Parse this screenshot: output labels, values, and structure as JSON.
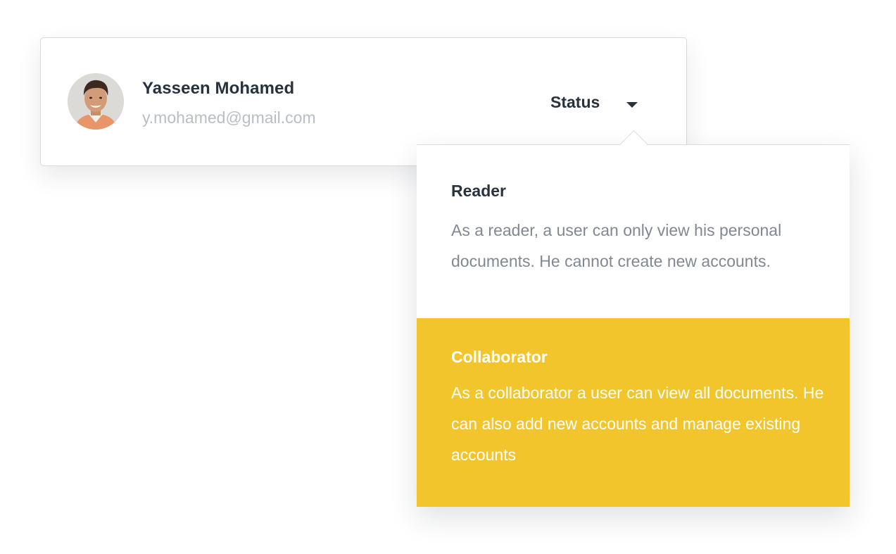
{
  "user": {
    "name": "Yasseen Mohamed",
    "email": "y.mohamed@gmail.com",
    "avatar_icon": "user-avatar-photo"
  },
  "status": {
    "label": "Status",
    "caret_icon": "caret-down-icon"
  },
  "dropdown": {
    "options": [
      {
        "title": "Reader",
        "description": "As a reader, a user can only view his personal documents. He cannot create new accounts.",
        "highlighted": false
      },
      {
        "title": "Collaborator",
        "description": "As a collaborator a user can view all documents. He can also add new accounts and manage existing accounts",
        "highlighted": true
      }
    ]
  },
  "colors": {
    "accent": "#f3c52d",
    "text_dark": "#27323f",
    "text_muted": "#818892",
    "email_gray": "#b9bec5"
  }
}
